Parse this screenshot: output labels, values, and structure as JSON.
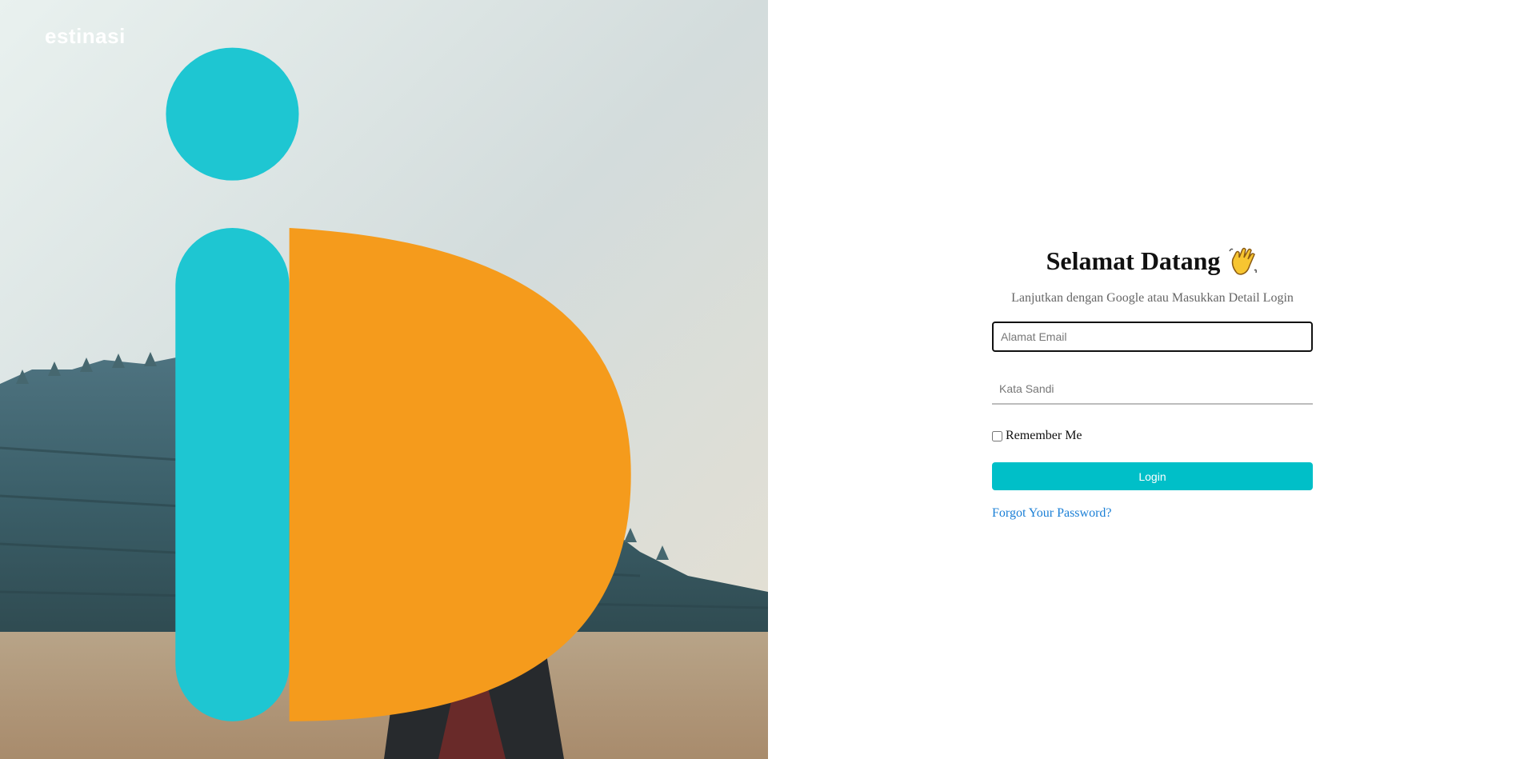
{
  "brand": {
    "logo_text": "estinasi",
    "logo_letter": "D"
  },
  "login": {
    "title": "Selamat Datang",
    "subtitle": "Lanjutkan dengan Google atau Masukkan Detail Login",
    "email_placeholder": "Alamat Email",
    "password_placeholder": "Kata Sandi",
    "remember_label": "Remember Me",
    "login_button": "Login",
    "forgot_link": "Forgot Your Password?"
  },
  "colors": {
    "accent": "#00bfc8",
    "link": "#1a7fd6",
    "logo_cyan": "#1ec6d2",
    "logo_orange": "#f59b1c"
  },
  "icons": {
    "greeting": "waving-hand-icon"
  }
}
